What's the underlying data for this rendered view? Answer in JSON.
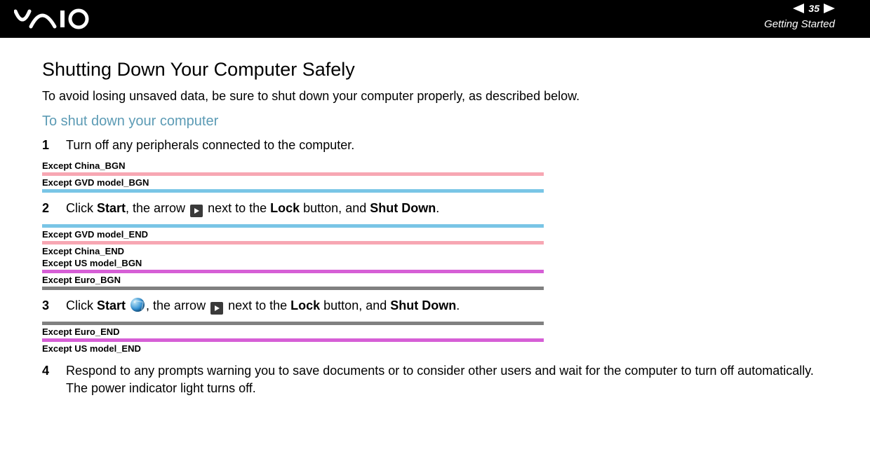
{
  "header": {
    "page_number": "35",
    "breadcrumb": "Getting Started",
    "logo_alt": "VAIO"
  },
  "title": "Shutting Down Your Computer Safely",
  "intro": "To avoid losing unsaved data, be sure to shut down your computer properly, as described below.",
  "subtitle": "To shut down your computer",
  "steps": {
    "s1": {
      "num": "1",
      "text": "Turn off any peripherals connected to the computer."
    },
    "s2": {
      "num": "2",
      "pre": "Click ",
      "start": "Start",
      "mid1": ", the arrow ",
      "mid2": " next to the ",
      "lock": "Lock",
      "mid3": " button, and ",
      "shut": "Shut Down",
      "post": "."
    },
    "s3": {
      "num": "3",
      "pre": "Click ",
      "start": "Start",
      "mid0": " ",
      "mid1": ", the arrow ",
      "mid2": " next to the ",
      "lock": "Lock",
      "mid3": " button, and ",
      "shut": "Shut Down",
      "post": "."
    },
    "s4": {
      "num": "4",
      "line1": "Respond to any prompts warning you to save documents or to consider other users and wait for the computer to turn off automatically.",
      "line2": "The power indicator light turns off."
    }
  },
  "markers": {
    "m1": "Except China_BGN",
    "m2": "Except GVD model_BGN",
    "m3": "Except GVD model_END",
    "m4": "Except China_END",
    "m5": "Except US model_BGN",
    "m6": "Except Euro_BGN",
    "m7": "Except Euro_END",
    "m8": "Except US model_END"
  }
}
